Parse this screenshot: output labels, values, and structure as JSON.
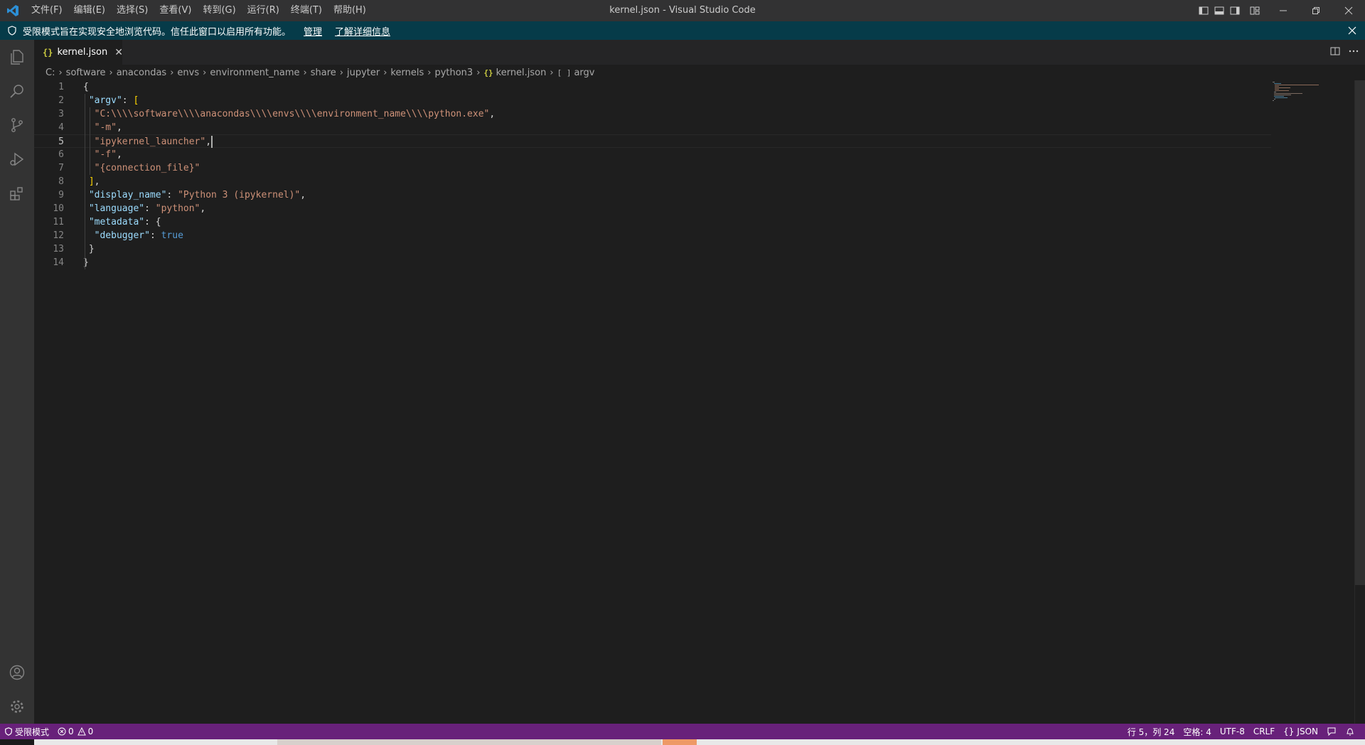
{
  "window": {
    "title": "kernel.json - Visual Studio Code",
    "menu": [
      "文件(F)",
      "编辑(E)",
      "选择(S)",
      "查看(V)",
      "转到(G)",
      "运行(R)",
      "终端(T)",
      "帮助(H)"
    ]
  },
  "banner": {
    "text": "受限模式旨在实现安全地浏览代码。信任此窗口以启用所有功能。",
    "manage_link": "管理",
    "learn_link": "了解详细信息"
  },
  "tab": {
    "icon": "{}",
    "label": "kernel.json",
    "close": "✕"
  },
  "breadcrumb": {
    "items": [
      "C:",
      "software",
      "anacondas",
      "envs",
      "environment_name",
      "share",
      "jupyter",
      "kernels",
      "python3"
    ],
    "file": "kernel.json",
    "file_icon": "{}",
    "symbol_icon": "[ ]",
    "symbol": "argv"
  },
  "editor": {
    "active_line": 5,
    "lines": [
      {
        "n": "1",
        "i": "",
        "t": [
          [
            "p",
            "{"
          ]
        ]
      },
      {
        "n": "2",
        "i": " ",
        "t": [
          [
            "k",
            "\"argv\""
          ],
          [
            "p",
            ": "
          ],
          [
            "ylw",
            "["
          ]
        ]
      },
      {
        "n": "3",
        "i": "  ",
        "t": [
          [
            "s",
            "\"C:\\\\\\\\software\\\\\\\\anacondas\\\\\\\\envs\\\\\\\\environment_name\\\\\\\\python.exe\""
          ],
          [
            "p",
            ","
          ]
        ]
      },
      {
        "n": "4",
        "i": "  ",
        "t": [
          [
            "s",
            "\"-m\""
          ],
          [
            "p",
            ","
          ]
        ]
      },
      {
        "n": "5",
        "i": "  ",
        "t": [
          [
            "s",
            "\"ipykernel_launcher\""
          ],
          [
            "p",
            ","
          ]
        ]
      },
      {
        "n": "6",
        "i": "  ",
        "t": [
          [
            "s",
            "\"-f\""
          ],
          [
            "p",
            ","
          ]
        ]
      },
      {
        "n": "7",
        "i": "  ",
        "t": [
          [
            "s",
            "\"{connection_file}\""
          ]
        ]
      },
      {
        "n": "8",
        "i": " ",
        "t": [
          [
            "ylw",
            "]"
          ],
          [
            "p",
            ","
          ]
        ]
      },
      {
        "n": "9",
        "i": " ",
        "t": [
          [
            "k",
            "\"display_name\""
          ],
          [
            "p",
            ": "
          ],
          [
            "s",
            "\"Python 3 (ipykernel)\""
          ],
          [
            "p",
            ","
          ]
        ]
      },
      {
        "n": "10",
        "i": " ",
        "t": [
          [
            "k",
            "\"language\""
          ],
          [
            "p",
            ": "
          ],
          [
            "s",
            "\"python\""
          ],
          [
            "p",
            ","
          ]
        ]
      },
      {
        "n": "11",
        "i": " ",
        "t": [
          [
            "k",
            "\"metadata\""
          ],
          [
            "p",
            ": {"
          ]
        ]
      },
      {
        "n": "12",
        "i": "  ",
        "t": [
          [
            "k",
            "\"debugger\""
          ],
          [
            "p",
            ": "
          ],
          [
            "b",
            "true"
          ]
        ]
      },
      {
        "n": "13",
        "i": " ",
        "t": [
          [
            "p",
            "}"
          ]
        ]
      },
      {
        "n": "14",
        "i": "",
        "t": [
          [
            "p",
            "}"
          ]
        ]
      }
    ]
  },
  "statusbar": {
    "restricted": "受限模式",
    "errors": "0",
    "warnings": "0",
    "position": "行 5，列 24",
    "spaces": "空格: 4",
    "encoding": "UTF-8",
    "eol": "CRLF",
    "language_icon": "{}",
    "language": "JSON"
  },
  "colors": {
    "statusbar": "#68217a",
    "banner": "#063b49",
    "string": "#ce9178",
    "key": "#9cdcfe",
    "keyword": "#569cd6"
  }
}
